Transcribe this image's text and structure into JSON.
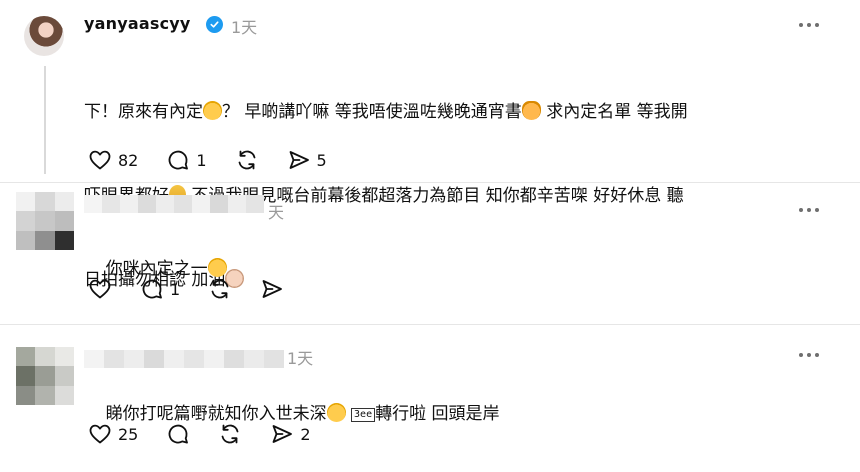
{
  "main_post": {
    "username": "yanyaascyy",
    "timestamp": "1天",
    "text_line1_a": "下！原來有內定",
    "text_line1_b": "？ 早啲講吖嘛 等我唔使溫咗幾晚通宵書",
    "text_line1_c": " 求內定名單 等我開",
    "text_line2_a": "吓眼界都好",
    "text_line2_b": " 不過我眼見嘅台前幕後都超落力為節目 知你都辛苦㗎 好好休息 聽",
    "text_line3": "日拍攝勿相認 加油",
    "likes": "82",
    "comments": "1",
    "reposts": "",
    "shares": "5"
  },
  "reply1": {
    "timestamp_fragment": "天",
    "text": "你咪內定之一",
    "likes": "",
    "comments": "1",
    "reposts": "",
    "shares": ""
  },
  "reply2": {
    "timestamp": "1天",
    "text_a": "睇你打呢篇嘢就知你入世未深",
    "text_glyph": "3ee",
    "text_b": "轉行啦 回頭是岸",
    "likes": "25",
    "comments": "",
    "reposts": "",
    "shares": "2"
  },
  "icons": {
    "like": "heart-icon",
    "comment": "comment-bubble-icon",
    "repost": "repost-icon",
    "share": "send-icon",
    "more": "more-options-icon",
    "verified": "verified-badge-icon"
  },
  "colors": {
    "verified": "#1d9bf0",
    "muted_text": "#9a9a9a",
    "divider": "#e6e6e6"
  }
}
